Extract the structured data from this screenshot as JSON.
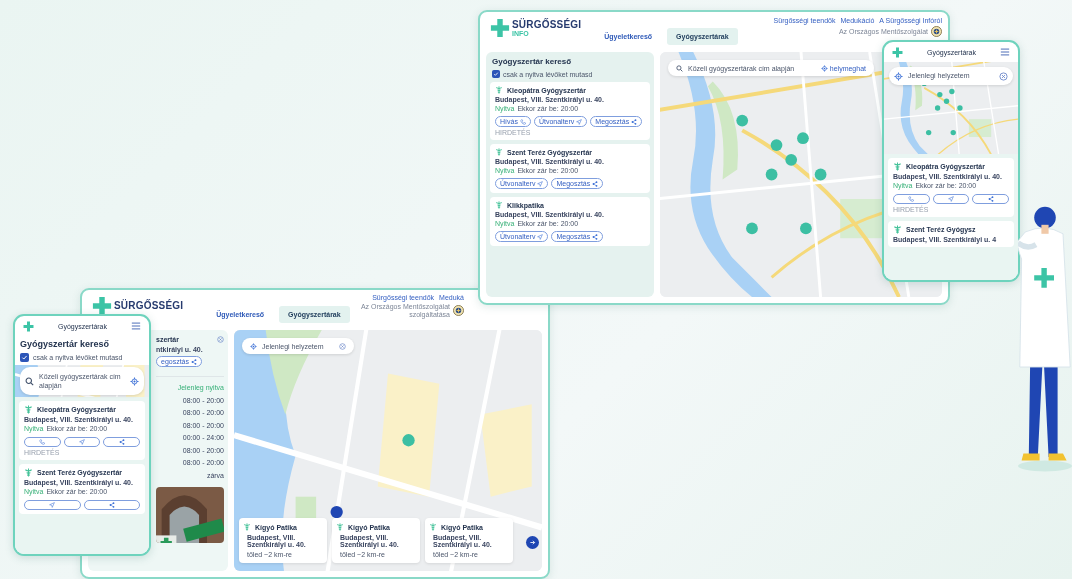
{
  "desktop_windows": [
    {
      "logo": {
        "word": "SÜRGŐSSÉGI",
        "sub": "INFO"
      },
      "nav_links": [
        "Sürgősségi teendők",
        "Medukáció",
        "A Sürgősségi Infóról"
      ],
      "tabs": [
        {
          "label": "Ügyeletkereső",
          "selected": false
        },
        {
          "label": "Gyógyszertárak",
          "selected": true
        }
      ],
      "operator": [
        "Az Országos Mentőszolgálat"
      ],
      "sidebar": {
        "kind": "search",
        "title": "Gyógyszertár kereső",
        "filter": {
          "label": "csak a nyitva lévőket mutasd",
          "checked": true
        },
        "pharmacies": [
          {
            "name": "Kleopátra Gyógyszertár",
            "address": "Budapest, VIII. Szentkirályi u. 40.",
            "status": "Nyitva",
            "closing": "Ekkor zár be: 20:00",
            "buttons": [
              {
                "kind": "call",
                "label": "Hívás"
              },
              {
                "kind": "route",
                "label": "Útvonalterv"
              },
              {
                "kind": "share",
                "label": "Megosztás"
              }
            ],
            "ad": "HIRDETÉS"
          },
          {
            "name": "Szent Teréz Gyógyszertár",
            "address": "Budapest, VIII. Szentkirályi u. 40.",
            "status": "Nyitva",
            "closing": "Ekkor zár be: 20:00",
            "buttons": [
              {
                "kind": "route",
                "label": "Útvonalterv"
              },
              {
                "kind": "share",
                "label": "Megosztás"
              }
            ]
          },
          {
            "name": "Klikkpatika",
            "address": "Budapest, VIII. Szentkirályi u. 40.",
            "status": "Nyitva",
            "closing": "Ekkor zár be: 20:00",
            "buttons": [
              {
                "kind": "route",
                "label": "Útvonalterv"
              },
              {
                "kind": "share",
                "label": "Megosztás"
              }
            ]
          }
        ]
      },
      "map": {
        "search": {
          "kind": "address",
          "placeholder": "Közeli gyógyszertárak cím alapján",
          "locate_label": "helymeghat"
        }
      }
    },
    {
      "logo": {
        "word": "SÜRGŐSSÉGI"
      },
      "nav_links": [
        "Sürgősségi teendők",
        "Meduká"
      ],
      "tabs": [
        {
          "label": "Ügyeletkereső",
          "selected": false
        },
        {
          "label": "Gyógyszertárak",
          "selected": true
        }
      ],
      "operator": [
        "Az Országos Mentőszolgálat",
        "szolgáltatása"
      ],
      "sidebar": {
        "kind": "detail",
        "name": "szertár",
        "address": "ntkirályi u. 40.",
        "share_label": "egosztás",
        "open_status": "Jelenleg nyitva",
        "hours": [
          "08:00 - 20:00",
          "08:00 - 20:00",
          "08:00 - 20:00",
          "00:00 - 24:00",
          "08:00 - 20:00",
          "08:00 - 20:00",
          "zárva"
        ]
      },
      "map": {
        "search": {
          "kind": "location",
          "value": "Jelenlegi helyzetem"
        },
        "results": [
          {
            "name": "Kígyó Patika",
            "address": "Budapest, VIII. Szentkirályi u. 40.",
            "distance": "tőled ~2 km-re"
          },
          {
            "name": "Kígyó Patika",
            "address": "Budapest, VIII. Szentkirályi u. 40.",
            "distance": "tőled ~2 km-re"
          },
          {
            "name": "Kígyó Patika",
            "address": "Budapest, VIII. Szentkirályi u. 40.",
            "distance": "tőled ~2 km-re"
          }
        ]
      }
    }
  ],
  "phones": [
    {
      "title": "Gyógyszertárak",
      "search": {
        "kind": "location",
        "value": "Jelenlegi helyzetem"
      },
      "pharmacies": [
        {
          "name": "Kleopátra Gyógyszertár",
          "address": "Budapest, VIII. Szentkirályi u. 40.",
          "status": "Nyitva",
          "closing": "Ekkor zár be: 20:00",
          "buttons": [
            {
              "kind": "call"
            },
            {
              "kind": "route"
            },
            {
              "kind": "share"
            }
          ],
          "ad": "HIRDETÉS"
        },
        {
          "name": "Szent Teréz Gyógysz",
          "address": "Budapest, VIII. Szentkirályi u. 4"
        }
      ]
    },
    {
      "title": "Gyógyszertárak",
      "heading": "Gyógyszertár kereső",
      "filter": {
        "label": "csak a nyitva lévőket mutasd",
        "checked": true
      },
      "search": {
        "kind": "address",
        "placeholder": "Közeli gyógyszertárak cím alapján"
      },
      "pharmacies": [
        {
          "name": "Kleopátra Gyógyszertár",
          "address": "Budapest, VIII. Szentkirályi u. 40.",
          "status": "Nyitva",
          "closing": "Ekkor zár be: 20:00",
          "buttons": [
            {
              "kind": "call"
            },
            {
              "kind": "route"
            },
            {
              "kind": "share"
            }
          ],
          "ad": "HIRDETÉS"
        },
        {
          "name": "Szent Teréz Gyógyszertár",
          "address": "Budapest, VIII. Szentkirályi u. 40.",
          "status": "Nyitva",
          "closing": "Ekkor zár be: 20:00",
          "buttons": [
            {
              "kind": "route"
            },
            {
              "kind": "share"
            }
          ]
        }
      ]
    }
  ]
}
